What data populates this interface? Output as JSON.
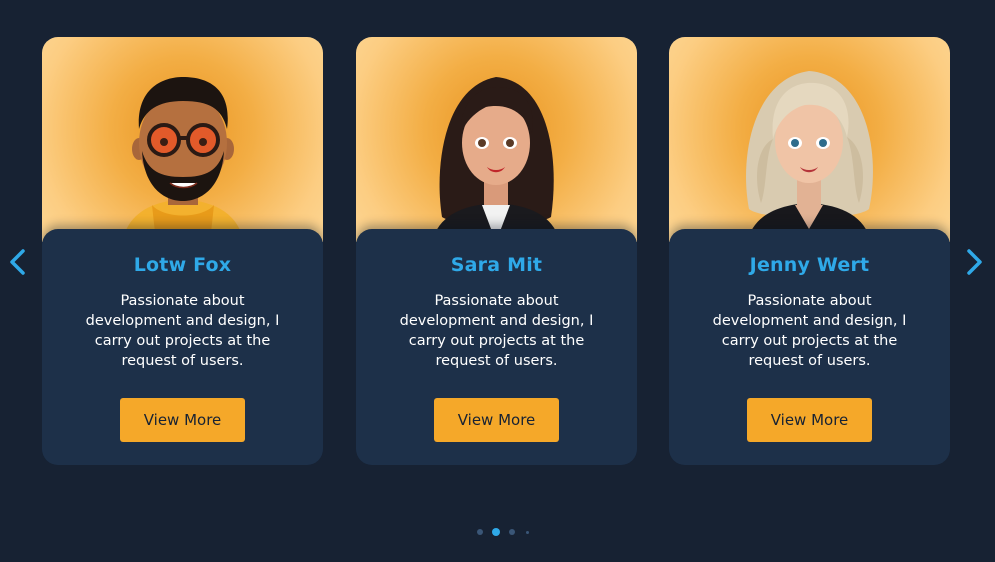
{
  "colors": {
    "background": "#172233",
    "card": "#1d3049",
    "accent": "#2fa9e8",
    "button": "#f5a829",
    "button_text": "#172233",
    "photo_bg": "#f3ae45",
    "dot_inactive": "#3a5677"
  },
  "navigation": {
    "prev_icon": "chevron-left-icon",
    "next_icon": "chevron-right-icon"
  },
  "cards": [
    {
      "name": "Lotw Fox",
      "description": "Passionate about development and design, I carry out projects at the request of users.",
      "button_label": "View More",
      "avatar": "bearded-man-glasses-avatar"
    },
    {
      "name": "Sara Mit",
      "description": "Passionate about development and design, I carry out projects at the request of users.",
      "button_label": "View More",
      "avatar": "dark-haired-woman-avatar"
    },
    {
      "name": "Jenny Wert",
      "description": "Passionate about development and design, I carry out projects at the request of users.",
      "button_label": "View More",
      "avatar": "blonde-woman-avatar"
    }
  ],
  "pagination": {
    "active_index": 1
  }
}
